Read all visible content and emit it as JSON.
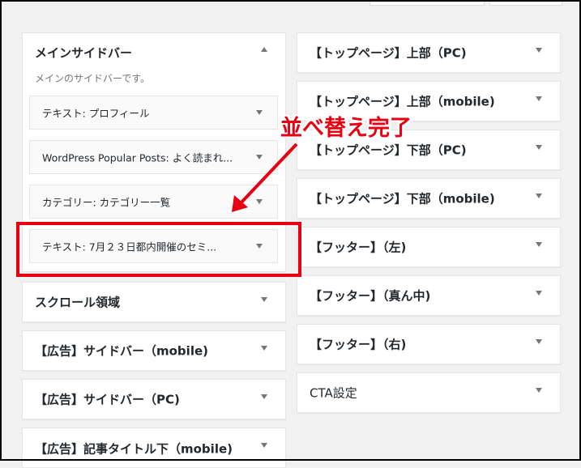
{
  "left_column": {
    "main_sidebar": {
      "title": "メインサイドバー",
      "description": "メインのサイドバーです。",
      "widgets": [
        {
          "label": "テキスト: プロフィール"
        },
        {
          "label": "WordPress Popular Posts: よく読まれ..."
        },
        {
          "label": "カテゴリー: カテゴリー一覧"
        },
        {
          "label": "テキスト: 7月２３日都内開催のセミ..."
        }
      ]
    },
    "areas": [
      {
        "title": "スクロール領域"
      },
      {
        "title": "【広告】サイドバー（mobile)"
      },
      {
        "title": "【広告】サイドバー（PC)"
      },
      {
        "title": "【広告】記事タイトル下（mobile)"
      }
    ]
  },
  "right_column": {
    "areas": [
      {
        "title": "【トップページ】上部（PC)"
      },
      {
        "title": "【トップページ】上部（mobile)"
      },
      {
        "title": "【トップページ】下部（PC)"
      },
      {
        "title": "【トップページ】下部（mobile)"
      },
      {
        "title": "【フッター】（左)"
      },
      {
        "title": "【フッター】（真ん中)"
      },
      {
        "title": "【フッター】（右)"
      },
      {
        "title": "CTA設定"
      }
    ]
  },
  "annotation": {
    "text": "並べ替え完了",
    "color": "#e60012"
  },
  "icons": {
    "expand": "chevron-down-icon",
    "collapse": "chevron-up-icon"
  }
}
